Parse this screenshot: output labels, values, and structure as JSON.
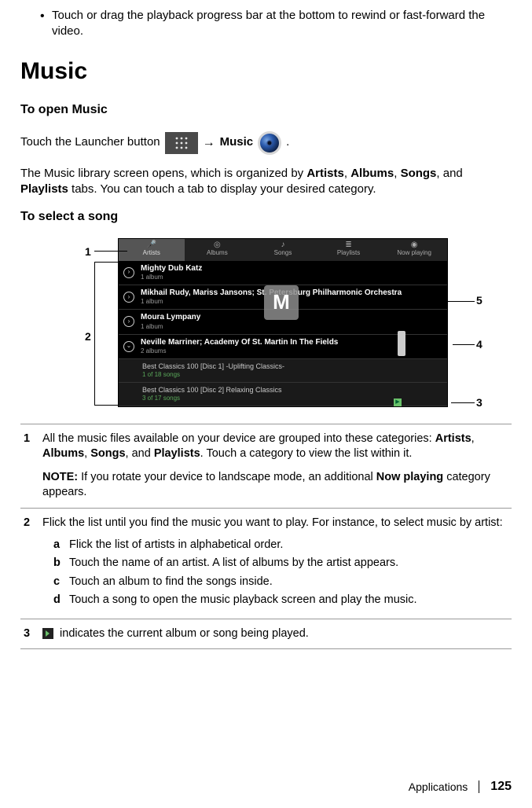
{
  "intro_bullet": "Touch or drag the playback progress bar at the bottom to rewind or fast-forward the video.",
  "heading": "Music",
  "open_heading": "To open Music",
  "launcher": {
    "pre": "Touch the Launcher button",
    "arrow": "→",
    "bold": "Music",
    "post": "."
  },
  "library_para_parts": {
    "a": "The Music library screen opens, which is organized by ",
    "b1": "Artists",
    "c1": ", ",
    "b2": "Albums",
    "c2": ", ",
    "b3": "Songs",
    "c3": ", and ",
    "b4": "Playlists",
    "d": " tabs. You can touch a tab to display your desired category."
  },
  "select_heading": "To select a song",
  "tabs": [
    "Artists",
    "Albums",
    "Songs",
    "Playlists",
    "Now playing"
  ],
  "artists": [
    {
      "name": "Mighty Dub Katz",
      "meta": "1 album"
    },
    {
      "name": "Mikhail Rudy, Mariss Jansons; St. Petersburg Philharmonic Orchestra",
      "meta": "1 album"
    },
    {
      "name": "Moura Lympany",
      "meta": "1 album"
    },
    {
      "name": "Neville Marriner; Academy Of St. Martin In The Fields",
      "meta": "2 albums"
    }
  ],
  "albums": [
    {
      "name": "Best Classics 100 [Disc 1] -Uplifting Classics-",
      "meta": "1 of 18 songs"
    },
    {
      "name": "Best Classics 100 [Disc 2] Relaxing Classics",
      "meta": "3 of 17 songs"
    }
  ],
  "scroll_letter": "M",
  "callouts": {
    "c1": "1",
    "c2": "2",
    "c3": "3",
    "c4": "4",
    "c5": "5"
  },
  "legend": {
    "r1": {
      "n": "1",
      "a": "All the music files available on your device are grouped into these categories: ",
      "b1": "Artists",
      "c1": ", ",
      "b2": "Albums",
      "c2": ", ",
      "b3": "Songs",
      "c3": ", and ",
      "b4": "Playlists",
      "d": ". Touch a category to view the list within it.",
      "note_label": "NOTE:",
      "note_a": " If you rotate your device to landscape mode, an additional ",
      "note_b": "Now playing",
      "note_c": " category appears."
    },
    "r2": {
      "n": "2",
      "intro": "Flick the list until you find the music you want to play. For instance, to select music by artist:",
      "a": "Flick the list of artists in alphabetical order.",
      "b": "Touch the name of an artist. A list of albums by the artist appears.",
      "c": "Touch an album to find the songs inside.",
      "d": "Touch a song to open the music playback screen and play the music."
    },
    "r3": {
      "n": "3",
      "txt": " indicates the current album or song being played."
    }
  },
  "footer": {
    "section": "Applications",
    "page": "125"
  }
}
